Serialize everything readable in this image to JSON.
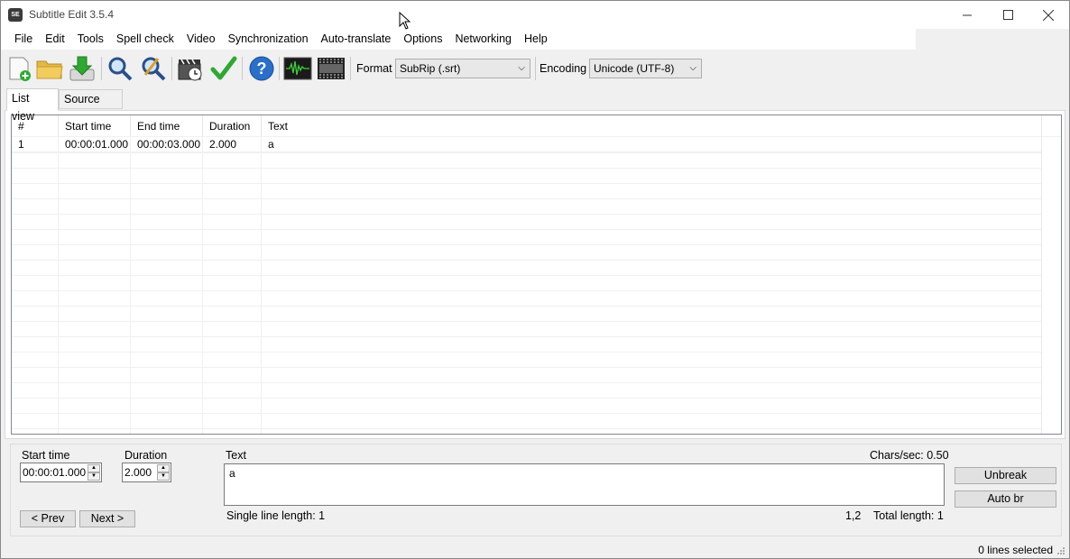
{
  "window": {
    "title": "Subtitle Edit 3.5.4",
    "app_icon_text": "SE"
  },
  "menu": [
    "File",
    "Edit",
    "Tools",
    "Spell check",
    "Video",
    "Synchronization",
    "Auto-translate",
    "Options",
    "Networking",
    "Help"
  ],
  "toolbar": {
    "format_label": "Format",
    "format_value": "SubRip (.srt)",
    "encoding_label": "Encoding",
    "encoding_value": "Unicode (UTF-8)"
  },
  "tabs": {
    "list_view": "List view",
    "source_view": "Source view"
  },
  "grid": {
    "columns": [
      "#",
      "Start time",
      "End time",
      "Duration",
      "Text"
    ],
    "rows": [
      [
        "1",
        "00:00:01.000",
        "00:00:03.000",
        "2.000",
        "a"
      ]
    ]
  },
  "edit": {
    "start_time_label": "Start time",
    "start_time_value": "00:00:01.000",
    "duration_label": "Duration",
    "duration_value": "2.000",
    "text_label": "Text",
    "chars_sec": "Chars/sec: 0.50",
    "text_value": "a",
    "prev_button": "< Prev",
    "next_button": "Next >",
    "unbreak_button": "Unbreak",
    "auto_br_button": "Auto br",
    "single_line_length": "Single line length: 1",
    "cursor_pos": "1,2",
    "total_length": "Total length: 1"
  },
  "status": {
    "selection": "0 lines selected"
  },
  "colors": {
    "accent_green": "#2fa832",
    "help_blue": "#2a6fc9"
  }
}
